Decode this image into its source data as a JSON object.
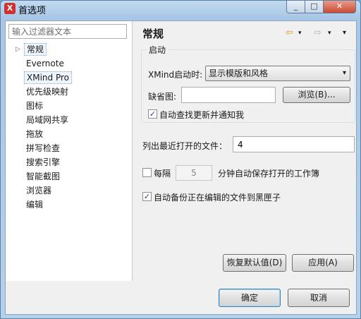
{
  "window": {
    "title": "首选项",
    "app_icon": "X",
    "min_glyph": "_",
    "max_glyph": "□",
    "close_glyph": "✕"
  },
  "filter": {
    "placeholder": "输入过滤器文本"
  },
  "tree": {
    "items": [
      {
        "label": "常规",
        "selected": true
      },
      {
        "label": "Evernote"
      },
      {
        "label": "XMind Pro",
        "focused": true
      },
      {
        "label": "优先级映射"
      },
      {
        "label": "图标"
      },
      {
        "label": "局域网共享"
      },
      {
        "label": "拖放"
      },
      {
        "label": "拼写检查"
      },
      {
        "label": "搜索引擎"
      },
      {
        "label": "智能截图"
      },
      {
        "label": "浏览器"
      },
      {
        "label": "编辑"
      }
    ],
    "expand_glyph": "▷"
  },
  "page": {
    "title": "常规",
    "nav": {
      "back_icon": "⇦",
      "forward_icon": "⇨",
      "menu_icon": "▾"
    }
  },
  "startup": {
    "group_title": "启动",
    "startup_label": "XMind启动时:",
    "startup_value": "显示模版和风格",
    "startup_caret": "▾",
    "default_label": "缺省图:",
    "default_value": "",
    "browse_label": "浏览(B)...",
    "auto_update_label": "自动查找更新并通知我",
    "auto_update_checked": true
  },
  "recent": {
    "label": "列出最近打开的文件：",
    "value": "4"
  },
  "autosave": {
    "checked": false,
    "prefix": "每隔",
    "minutes": "5",
    "suffix": "分钟自动保存打开的工作簿"
  },
  "backup": {
    "checked": true,
    "label": "自动备份正在编辑的文件到黑匣子"
  },
  "buttons": {
    "restore_defaults": "恢复默认值(D)",
    "apply": "应用(A)",
    "ok": "确定",
    "cancel": "取消"
  },
  "checkmark": "✓",
  "colors": {
    "titlebar": "#b5d0ea",
    "accent": "#3c7fb1",
    "close": "#c94a32"
  }
}
